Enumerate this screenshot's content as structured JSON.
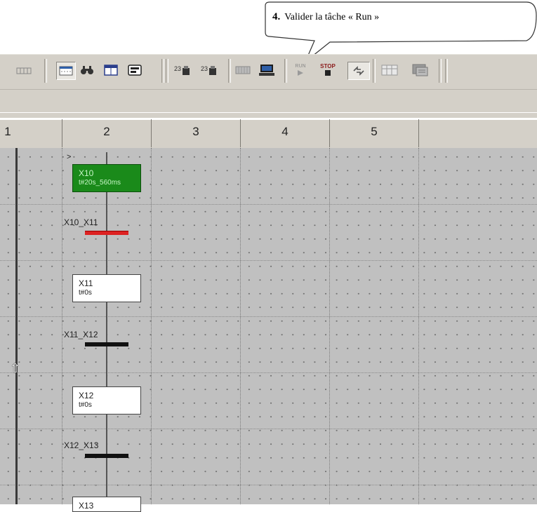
{
  "callout": {
    "step_number": "4.",
    "text": "Valider la tâche « Run »"
  },
  "toolbar": {
    "icons": [
      "grid-icon",
      "dotted-grid-icon",
      "binoculars-icon",
      "window-icon",
      "panel-icon",
      "debug-icon-1",
      "debug-icon-2",
      "memory-icon",
      "computer-icon",
      "run-icon",
      "stop-icon",
      "cycle-icon",
      "table-icon",
      "config-icon"
    ],
    "run_label": "RUN",
    "stop_label": "STOP"
  },
  "columns": [
    "1",
    "2",
    "3",
    "4",
    "5"
  ],
  "chart": {
    "initial_marker": ">",
    "steps": [
      {
        "name": "X10",
        "time": "t#20s_560ms",
        "active": true
      },
      {
        "name": "X11",
        "time": "t#0s",
        "active": false
      },
      {
        "name": "X12",
        "time": "t#0s",
        "active": false
      },
      {
        "name": "X13",
        "time": "",
        "active": false
      }
    ],
    "transitions": [
      {
        "name": "X10_X11",
        "state": "active"
      },
      {
        "name": "X11_X12",
        "state": "inactive"
      },
      {
        "name": "X12_X13",
        "state": "inactive"
      }
    ]
  },
  "colors": {
    "active_step": "#1a8a1a",
    "active_transition": "#d22222",
    "grid_bg": "#c0c0c0"
  }
}
